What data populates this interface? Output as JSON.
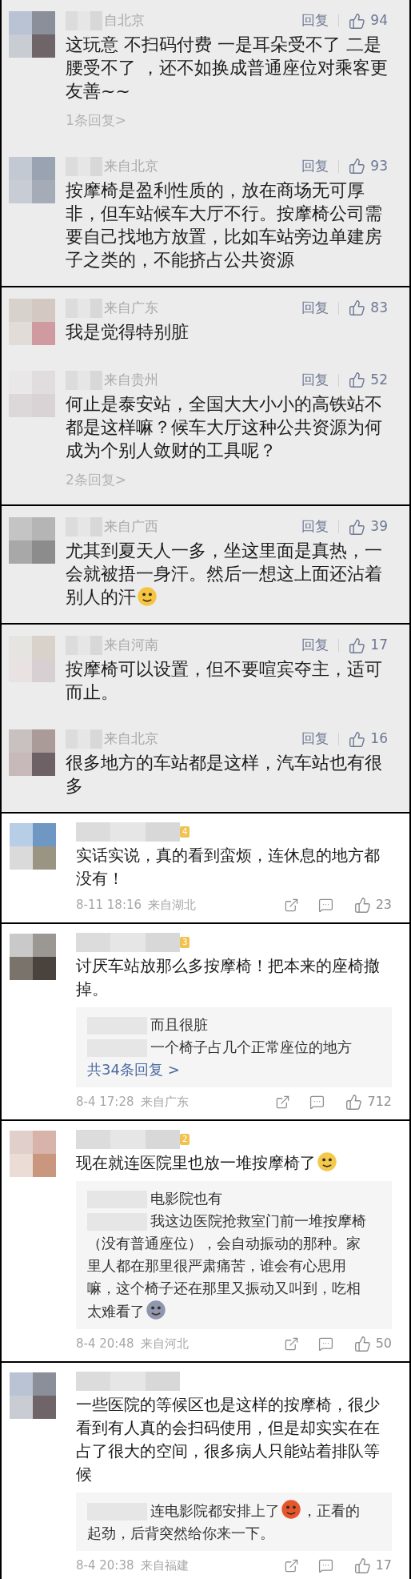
{
  "panels": [
    {
      "kind": "gray",
      "comments": [
        {
          "location": "自北京",
          "reply": "回复",
          "likes": "94",
          "body": [
            {
              "kind": "text",
              "text": "这玩意 不扫码付费 一是耳朵受不了 二是腰受不了 ，还不如换成普通座位对乘客更友善~~"
            }
          ],
          "replies_link": "1条回复>"
        },
        {
          "location": "来自北京",
          "reply": "回复",
          "likes": "93",
          "body": [
            {
              "kind": "text",
              "text": "按摩椅是盈利性质的，放在商场无可厚非，但车站候车大厅不行。按摩椅公司需要自己找地方放置，比如车站旁边单建房子之类的，不能挤占公共资源"
            }
          ]
        }
      ]
    },
    {
      "kind": "gray",
      "comments": [
        {
          "location": "来自广东",
          "reply": "回复",
          "likes": "83",
          "body": [
            {
              "kind": "text",
              "text": "我是觉得特别脏"
            }
          ]
        },
        {
          "location": "来自贵州",
          "reply": "回复",
          "likes": "52",
          "body": [
            {
              "kind": "text",
              "text": "何止是泰安站，全国大大小小的高铁站不都是这样嘛？候车大厅这种公共资源为何成为个别人敛财的工具呢？"
            }
          ],
          "replies_link": "2条回复>"
        }
      ]
    },
    {
      "kind": "gray",
      "comments": [
        {
          "location": "来自广西",
          "reply": "回复",
          "likes": "39",
          "body": [
            {
              "kind": "text",
              "text": "尤其到夏天人一多，坐这里面是真热，一会就被捂一身汗。然后一想这上面还沾着别人的汗"
            },
            {
              "kind": "emoji",
              "color": "#f5c542"
            }
          ]
        }
      ]
    },
    {
      "kind": "gray",
      "comments": [
        {
          "location": "来自河南",
          "reply": "回复",
          "likes": "17",
          "body": [
            {
              "kind": "text",
              "text": "按摩椅可以设置，但不要喧宾夺主，适可而止。"
            }
          ]
        },
        {
          "location": "来自北京",
          "reply": "回复",
          "likes": "16",
          "body": [
            {
              "kind": "text",
              "text": "很多地方的车站都是这样，汽车站也有很多"
            }
          ]
        }
      ]
    },
    {
      "kind": "white",
      "comments": [
        {
          "badge": "4",
          "body": [
            {
              "kind": "text",
              "text": "实话实说，真的看到蛮烦，连休息的地方都没有！"
            }
          ],
          "time": "8-11 18:16",
          "location": "来自湖北",
          "likes": "23"
        }
      ]
    },
    {
      "kind": "white",
      "comments": [
        {
          "badge": "3",
          "body": [
            {
              "kind": "text",
              "text": "讨厌车站放那么多按摩椅！把本来的座椅撤掉。"
            }
          ],
          "replies": [
            {
              "segments": [
                {
                  "kind": "text",
                  "text": "而且很脏"
                }
              ]
            },
            {
              "segments": [
                {
                  "kind": "text",
                  "text": "一个椅子占几个正常座位的地方"
                }
              ]
            }
          ],
          "more": "共34条回复 >",
          "time": "8-4 17:28",
          "location": "来自广东",
          "likes": "712"
        }
      ]
    },
    {
      "kind": "white",
      "comments": [
        {
          "badge": "2",
          "body": [
            {
              "kind": "text",
              "text": "现在就连医院里也放一堆按摩椅了"
            },
            {
              "kind": "emoji",
              "color": "#f2c94c"
            }
          ],
          "replies": [
            {
              "segments": [
                {
                  "kind": "text",
                  "text": "电影院也有"
                }
              ]
            },
            {
              "segments": [
                {
                  "kind": "text",
                  "text": "我这边医院抢救室门前一堆按摩椅（没有普通座位），会自动振动的那种。家里人都在那里很严肃痛苦，谁会有心思用嘛，这个椅子还在那里又振动又叫到，吃相太难看了"
                },
                {
                  "kind": "emoji",
                  "color": "#8f96b0"
                }
              ]
            }
          ],
          "time": "8-4 20:48",
          "location": "来自河北",
          "likes": "50"
        }
      ]
    },
    {
      "kind": "white",
      "comments": [
        {
          "body": [
            {
              "kind": "text",
              "text": "一些医院的等候区也是这样的按摩椅，很少看到有人真的会扫码使用，但是却实实在在占了很大的空间，很多病人只能站着排队等候"
            }
          ],
          "replies": [
            {
              "segments": [
                {
                  "kind": "text",
                  "text": "连电影院都安排上了"
                },
                {
                  "kind": "emoji",
                  "color": "#e4572e"
                },
                {
                  "kind": "text",
                  "text": "，正看的起劲，后背突然给你来一下。"
                }
              ]
            }
          ],
          "time": "8-4 20:38",
          "location": "来自福建",
          "likes": "17"
        }
      ]
    }
  ]
}
